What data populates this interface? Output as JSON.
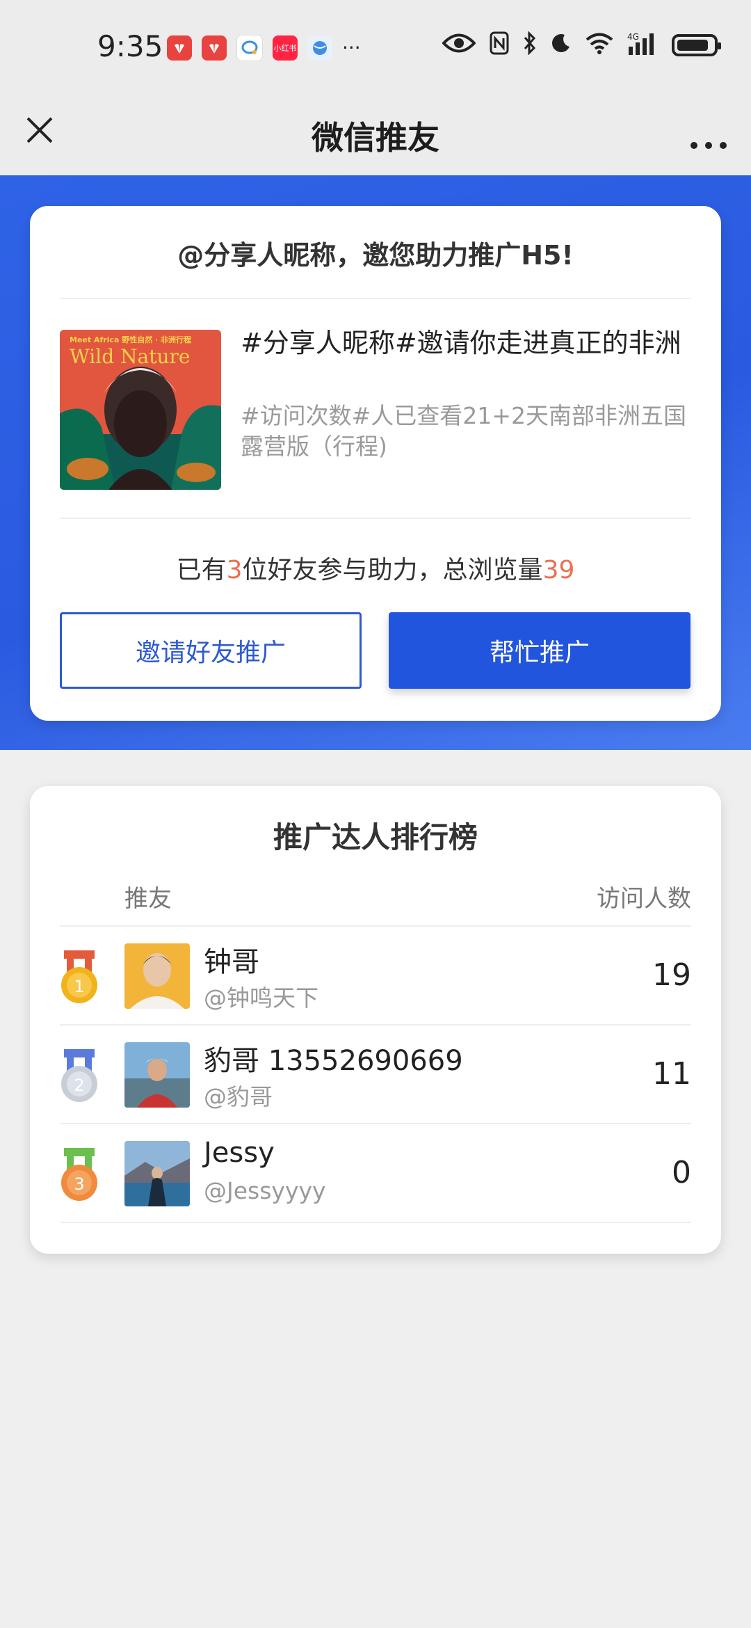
{
  "status_bar": {
    "time": "9:35",
    "apps": [
      {
        "name": "huawei-app-icon",
        "color": "#e8433e",
        "label": ""
      },
      {
        "name": "huawei-app-icon",
        "color": "#e8433e",
        "label": ""
      },
      {
        "name": "chat-app-icon",
        "color": "#ffffff",
        "label": ""
      },
      {
        "name": "xiaohongshu-icon",
        "color": "#ff2442",
        "label": "小红书"
      },
      {
        "name": "browser-icon",
        "color": "#3b8fe8",
        "label": ""
      }
    ],
    "more": "···",
    "network": "4G"
  },
  "nav": {
    "title": "微信推友"
  },
  "share_card": {
    "heading": "@分享人昵称，邀您助力推广H5!",
    "item_title": "#分享人昵称#邀请你走进真正的非洲",
    "item_subtitle": "#访问次数#人已查看21+2天南部非洲五国 露营版（行程)",
    "cover_text_top": "Meet Africa  野性自然 · 非洲行程",
    "cover_text_main": "Wild Nature",
    "stats_prefix": "已有",
    "friends_count": "3",
    "stats_middle": "位好友参与助力，总浏览量",
    "total_views": "39",
    "invite_button": "邀请好友推广",
    "help_button": "帮忙推广"
  },
  "ranking": {
    "title": "推广达人排行榜",
    "col_user": "推友",
    "col_visits": "访问人数",
    "rows": [
      {
        "rank": "1",
        "name": "钟哥",
        "handle": "@钟鸣天下",
        "visits": "19",
        "medal_color": "#f2b21c",
        "ribbon": "#e45b3c"
      },
      {
        "rank": "2",
        "name": "豹哥 13552690669",
        "handle": "@豹哥",
        "visits": "11",
        "medal_color": "#c7ced6",
        "ribbon": "#5a7bdc"
      },
      {
        "rank": "3",
        "name": "Jessy",
        "handle": "@Jessyyyy",
        "visits": "0",
        "medal_color": "#f08a3c",
        "ribbon": "#6bbf4e"
      }
    ]
  },
  "colors": {
    "accent_blue": "#2255dd",
    "highlight_orange": "#ec6f50"
  }
}
